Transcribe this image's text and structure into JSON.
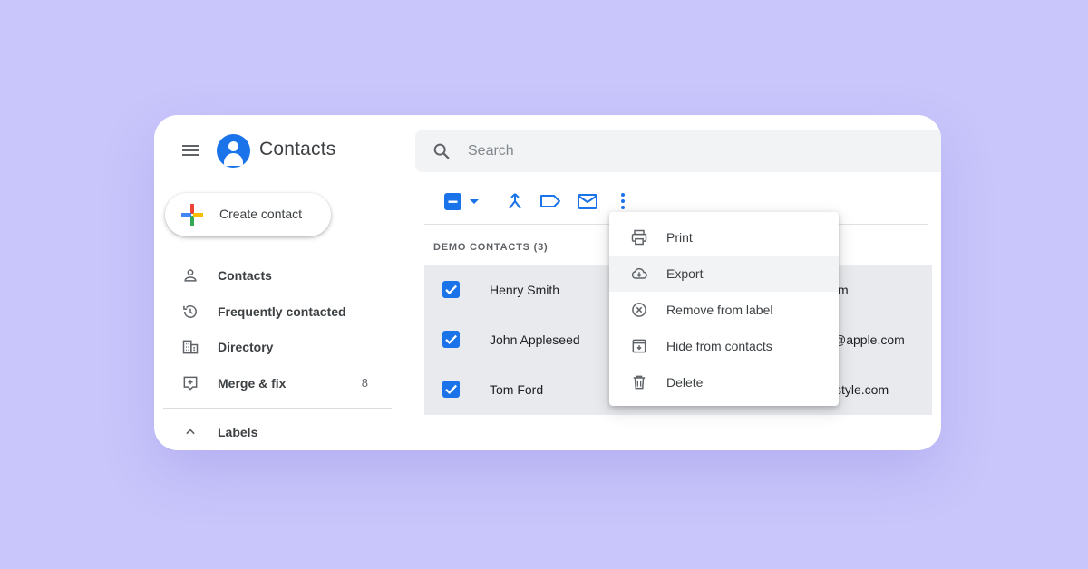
{
  "app": {
    "title": "Contacts"
  },
  "create_button": {
    "label": "Create contact"
  },
  "sidebar": {
    "items": [
      {
        "label": "Contacts",
        "icon": "person-icon",
        "count": ""
      },
      {
        "label": "Frequently contacted",
        "icon": "history-icon",
        "count": ""
      },
      {
        "label": "Directory",
        "icon": "building-icon",
        "count": ""
      },
      {
        "label": "Merge & fix",
        "icon": "merge-fix-icon",
        "count": "8"
      },
      {
        "label": "Labels",
        "icon": "chevron-up-icon",
        "count": ""
      }
    ]
  },
  "search": {
    "placeholder": "Search",
    "value": ""
  },
  "toolbar": {
    "icons": [
      "select-all-checkbox-icon",
      "dropdown-arrow-icon",
      "merge-icon",
      "label-icon",
      "email-icon",
      "more-vert-icon"
    ]
  },
  "contacts": {
    "section_header": "DEMO CONTACTS (3)",
    "rows": [
      {
        "name": "Henry Smith",
        "email_visible": "m",
        "checked": true
      },
      {
        "name": "John Appleseed",
        "email_visible": "@apple.com",
        "checked": true
      },
      {
        "name": "Tom Ford",
        "email_visible": "style.com",
        "checked": true
      }
    ]
  },
  "menu": {
    "items": [
      {
        "label": "Print",
        "icon": "print-icon"
      },
      {
        "label": "Export",
        "icon": "cloud-download-icon"
      },
      {
        "label": "Remove from label",
        "icon": "remove-circle-icon"
      },
      {
        "label": "Hide from contacts",
        "icon": "archive-icon"
      },
      {
        "label": "Delete",
        "icon": "trash-icon"
      }
    ]
  },
  "colors": {
    "background": "#c9c6fb",
    "accent": "#1a73e8",
    "selected_row": "#e8eaed",
    "search_bg": "#f1f3f4"
  }
}
